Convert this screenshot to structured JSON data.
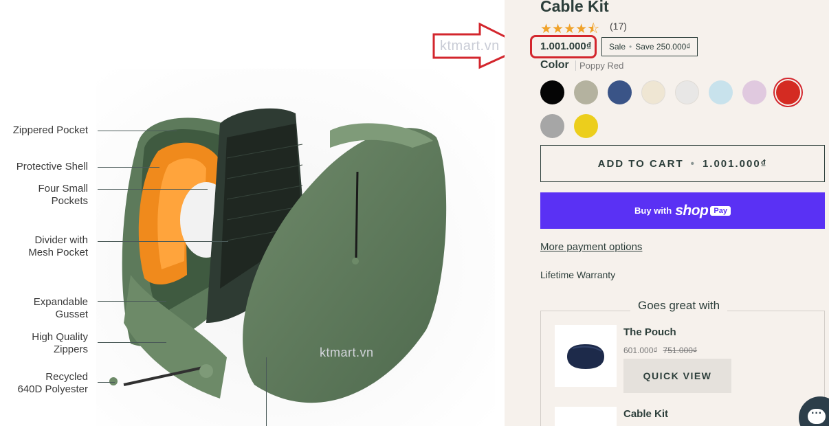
{
  "image_panel": {
    "callouts": [
      {
        "id": "zippered-pocket",
        "text": "Zippered Pocket"
      },
      {
        "id": "protective-shell",
        "text": "Protective Shell"
      },
      {
        "id": "four-small-pockets",
        "line1": "Four Small",
        "line2": "Pockets"
      },
      {
        "id": "divider-mesh",
        "line1": "Divider with",
        "line2": "Mesh Pocket"
      },
      {
        "id": "expandable-gusset",
        "line1": "Expandable",
        "line2": "Gusset"
      },
      {
        "id": "high-quality-zippers",
        "line1": "High Quality",
        "line2": "Zippers"
      },
      {
        "id": "recycled-polyester",
        "line1": "Recycled",
        "line2": "640D Polyester"
      }
    ],
    "watermark_top": "ktmart.vn",
    "watermark_center": "ktmart.vn"
  },
  "product": {
    "title": "Cable Kit",
    "rating_stars": "★★★★⯪",
    "rating": 4.5,
    "review_count": "(17)",
    "price": "1.001.000₫",
    "sale_label": "Sale",
    "save_label": "Save 250.000₫",
    "color_label": "Color",
    "color_value": "Poppy Red",
    "swatches": [
      {
        "name": "Black",
        "hex": "#050505"
      },
      {
        "name": "Sage",
        "hex": "#b4b29f"
      },
      {
        "name": "Navy",
        "hex": "#3a5487"
      },
      {
        "name": "Cream",
        "hex": "#efe6d3"
      },
      {
        "name": "Light Gray",
        "hex": "#e8e7e6"
      },
      {
        "name": "Sky Blue",
        "hex": "#c8e2ec"
      },
      {
        "name": "Lilac",
        "hex": "#e0c9df"
      },
      {
        "name": "Poppy Red",
        "hex": "#d42b22",
        "selected": true
      },
      {
        "name": "Gray",
        "hex": "#a6a6a6"
      },
      {
        "name": "Yellow",
        "hex": "#ecce1c"
      }
    ],
    "add_to_cart": "ADD TO CART",
    "add_to_cart_price": "1.001.000₫",
    "shop_pay_prefix": "Buy with",
    "shop_pay_brand": "shop",
    "shop_pay_badge": "Pay",
    "more_payment": "More payment options",
    "warranty": "Lifetime Warranty"
  },
  "goes_great_with": {
    "title": "Goes great with",
    "items": [
      {
        "name": "The Pouch",
        "price": "601.000₫",
        "old_price": "751.000₫",
        "button": "QUICK VIEW"
      },
      {
        "name": "Cable Kit"
      }
    ]
  },
  "colors": {
    "accent_red": "#d3262d",
    "primary_text": "#2c3e3a",
    "shop_pay": "#5a31f4",
    "panel_bg": "#f6f1ec",
    "star": "#f0a22a"
  }
}
